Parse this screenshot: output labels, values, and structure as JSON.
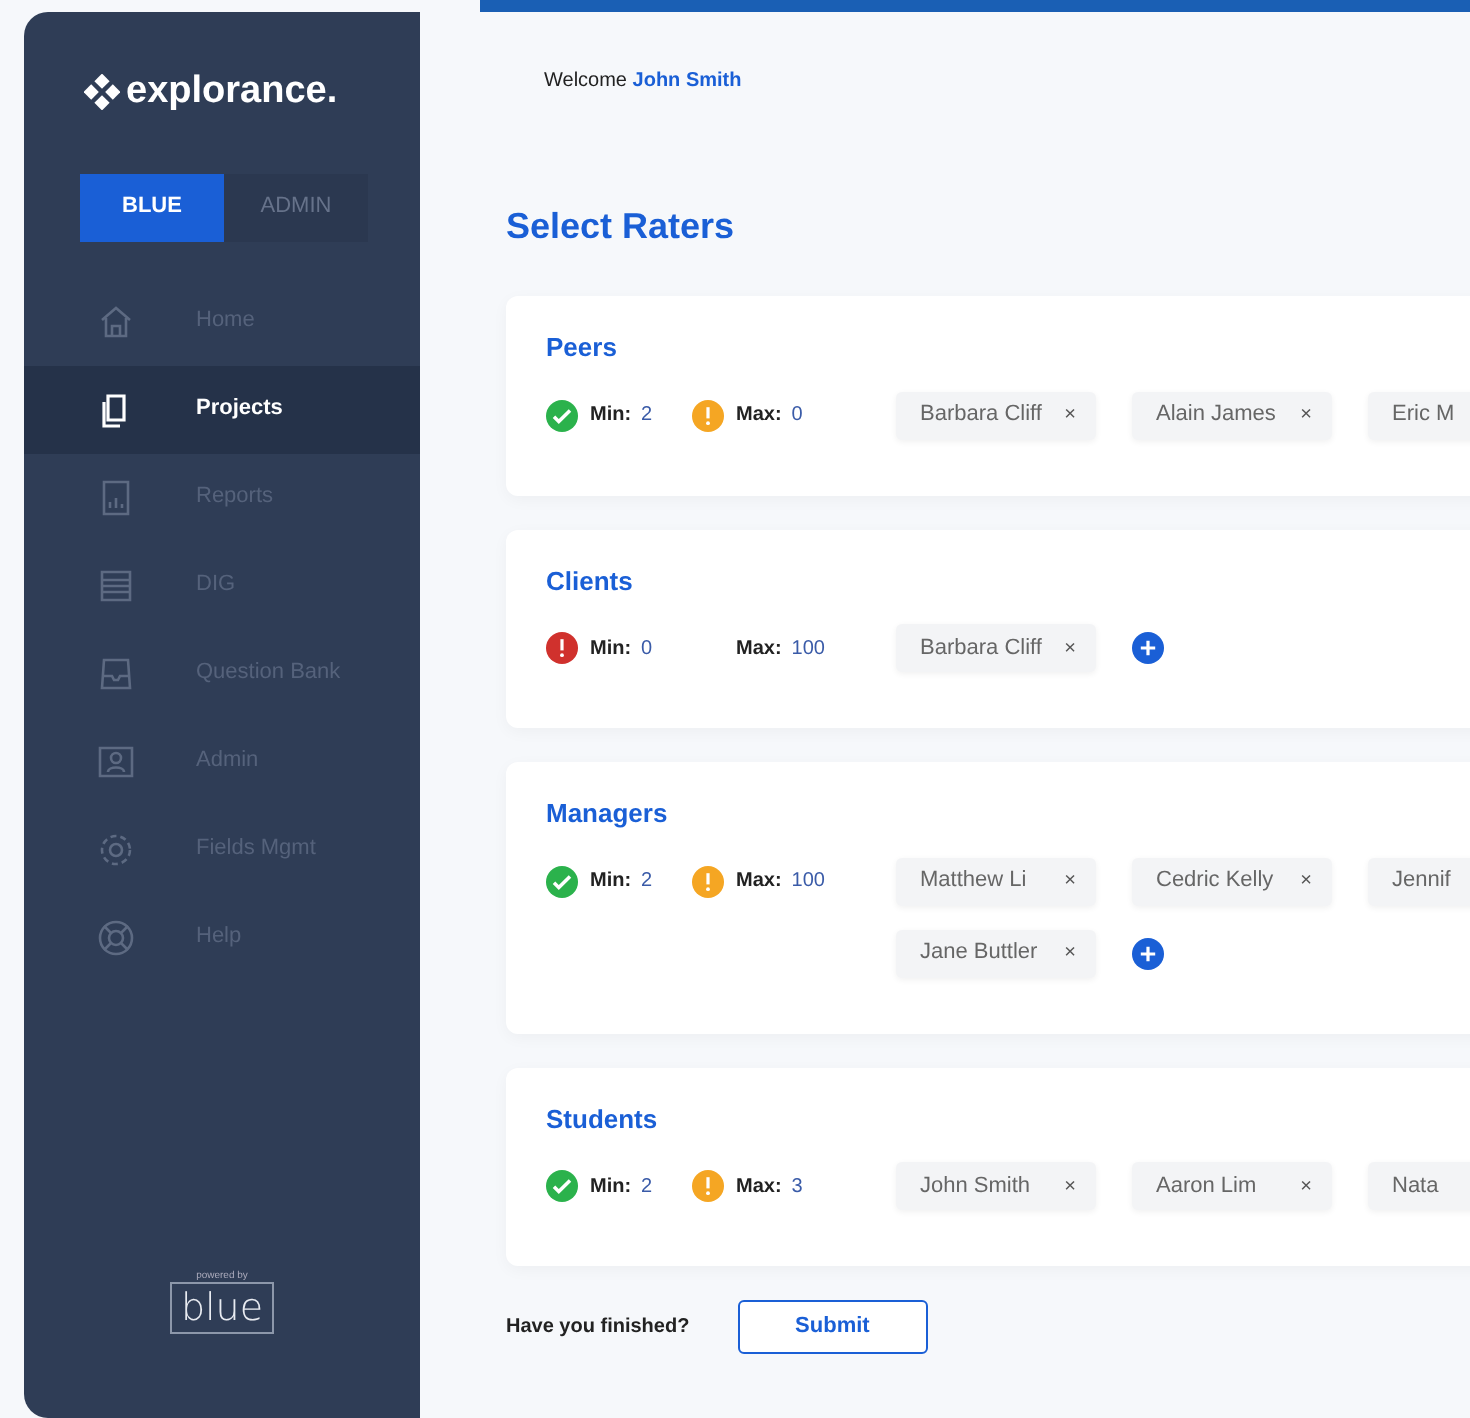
{
  "brand": {
    "name": "explorance."
  },
  "mode_tabs": [
    {
      "label": "BLUE",
      "selected": true
    },
    {
      "label": "ADMIN",
      "selected": false
    }
  ],
  "sidebar": {
    "items": [
      {
        "label": "Home",
        "selected": false
      },
      {
        "label": "Projects",
        "selected": true
      },
      {
        "label": "Reports",
        "selected": false
      },
      {
        "label": "DIG",
        "selected": false
      },
      {
        "label": "Question Bank",
        "selected": false
      },
      {
        "label": "Admin",
        "selected": false
      },
      {
        "label": "Fields Mgmt",
        "selected": false
      },
      {
        "label": "Help",
        "selected": false
      }
    ],
    "footer": {
      "caption": "powered by",
      "logo": "blue"
    }
  },
  "welcome": {
    "prefix": "Welcome",
    "user": "John Smith"
  },
  "title": "Select Raters",
  "groups": [
    {
      "name": "Peers",
      "limits": [
        {
          "kind": "ok",
          "label": "Min:",
          "value": "2"
        },
        {
          "kind": "warn",
          "label": "Max:",
          "value": "0"
        }
      ],
      "raters": [
        {
          "name": "Barbara Cliff",
          "remove": "×"
        },
        {
          "name": "Alain James",
          "remove": "×"
        },
        {
          "name": "Eric M"
        }
      ],
      "can_add": false
    },
    {
      "name": "Clients",
      "limits": [
        {
          "kind": "error",
          "label": "Min:",
          "value": "0"
        },
        {
          "kind": "none",
          "label": "Max:",
          "value": "100"
        }
      ],
      "raters": [
        {
          "name": "Barbara Cliff",
          "remove": "×"
        }
      ],
      "can_add": true
    },
    {
      "name": "Managers",
      "limits": [
        {
          "kind": "ok",
          "label": "Min:",
          "value": "2"
        },
        {
          "kind": "warn",
          "label": "Max:",
          "value": "100"
        }
      ],
      "raters": [
        {
          "name": "Matthew Li",
          "remove": "×"
        },
        {
          "name": "Cedric Kelly",
          "remove": "×"
        },
        {
          "name": "Jennif"
        },
        {
          "name": "Jane Buttler",
          "remove": "×"
        }
      ],
      "can_add": true
    },
    {
      "name": "Students",
      "limits": [
        {
          "kind": "ok",
          "label": "Min:",
          "value": "2"
        },
        {
          "kind": "warn",
          "label": "Max:",
          "value": "3"
        }
      ],
      "raters": [
        {
          "name": "John Smith",
          "remove": "×"
        },
        {
          "name": "Aaron Lim",
          "remove": "×"
        },
        {
          "name": "Nata"
        }
      ],
      "can_add": false
    }
  ],
  "footer": {
    "question": "Have you finished?",
    "submit": "Submit"
  }
}
